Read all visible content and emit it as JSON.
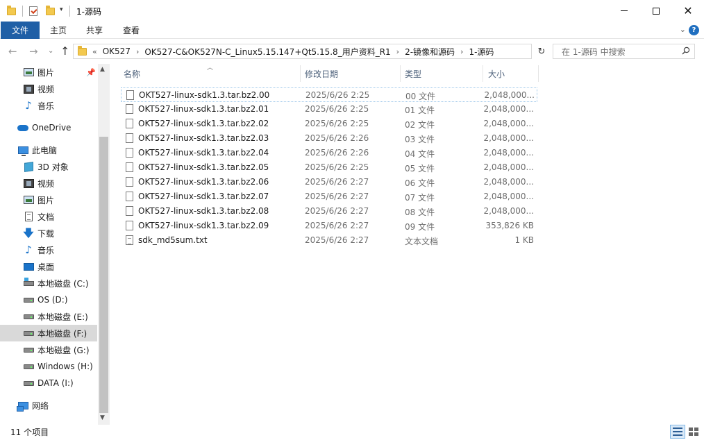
{
  "window": {
    "title": "1-源码"
  },
  "ribbon": {
    "tabs": [
      "文件",
      "主页",
      "共享",
      "查看"
    ]
  },
  "address": {
    "lead": "«",
    "segments": [
      "OK527",
      "OK527-C&OK527N-C_Linux5.15.147+Qt5.15.8_用户资料_R1",
      "2-镜像和源码",
      "1-源码"
    ]
  },
  "search": {
    "placeholder": "在 1-源码 中搜索"
  },
  "sidebar": {
    "items": [
      {
        "label": "图片",
        "icon": "pictures-icon"
      },
      {
        "label": "视频",
        "icon": "videos-icon"
      },
      {
        "label": "音乐",
        "icon": "music-icon"
      },
      {
        "label": "OneDrive",
        "icon": "onedrive-icon"
      },
      {
        "label": "此电脑",
        "icon": "this-pc-icon"
      },
      {
        "label": "3D 对象",
        "icon": "3d-objects-icon"
      },
      {
        "label": "视频",
        "icon": "videos-icon"
      },
      {
        "label": "图片",
        "icon": "pictures-icon"
      },
      {
        "label": "文档",
        "icon": "documents-icon"
      },
      {
        "label": "下载",
        "icon": "downloads-icon"
      },
      {
        "label": "音乐",
        "icon": "music-icon"
      },
      {
        "label": "桌面",
        "icon": "desktop-icon"
      },
      {
        "label": "本地磁盘 (C:)",
        "icon": "system-drive-icon"
      },
      {
        "label": "OS (D:)",
        "icon": "drive-icon"
      },
      {
        "label": "本地磁盘 (E:)",
        "icon": "drive-icon"
      },
      {
        "label": "本地磁盘 (F:)",
        "icon": "drive-icon",
        "selected": true
      },
      {
        "label": "本地磁盘 (G:)",
        "icon": "drive-icon"
      },
      {
        "label": "Windows (H:)",
        "icon": "drive-icon"
      },
      {
        "label": "DATA (I:)",
        "icon": "drive-icon"
      },
      {
        "label": "网络",
        "icon": "network-icon"
      }
    ]
  },
  "columns": {
    "name": "名称",
    "date": "修改日期",
    "type": "类型",
    "size": "大小"
  },
  "files": [
    {
      "name": "OKT527-linux-sdk1.3.tar.bz2.00",
      "date": "2025/6/26 2:25",
      "type": "00 文件",
      "size": "2,048,000..."
    },
    {
      "name": "OKT527-linux-sdk1.3.tar.bz2.01",
      "date": "2025/6/26 2:25",
      "type": "01 文件",
      "size": "2,048,000..."
    },
    {
      "name": "OKT527-linux-sdk1.3.tar.bz2.02",
      "date": "2025/6/26 2:25",
      "type": "02 文件",
      "size": "2,048,000..."
    },
    {
      "name": "OKT527-linux-sdk1.3.tar.bz2.03",
      "date": "2025/6/26 2:26",
      "type": "03 文件",
      "size": "2,048,000..."
    },
    {
      "name": "OKT527-linux-sdk1.3.tar.bz2.04",
      "date": "2025/6/26 2:26",
      "type": "04 文件",
      "size": "2,048,000..."
    },
    {
      "name": "OKT527-linux-sdk1.3.tar.bz2.05",
      "date": "2025/6/26 2:25",
      "type": "05 文件",
      "size": "2,048,000..."
    },
    {
      "name": "OKT527-linux-sdk1.3.tar.bz2.06",
      "date": "2025/6/26 2:27",
      "type": "06 文件",
      "size": "2,048,000..."
    },
    {
      "name": "OKT527-linux-sdk1.3.tar.bz2.07",
      "date": "2025/6/26 2:27",
      "type": "07 文件",
      "size": "2,048,000..."
    },
    {
      "name": "OKT527-linux-sdk1.3.tar.bz2.08",
      "date": "2025/6/26 2:27",
      "type": "08 文件",
      "size": "2,048,000..."
    },
    {
      "name": "OKT527-linux-sdk1.3.tar.bz2.09",
      "date": "2025/6/26 2:27",
      "type": "09 文件",
      "size": "353,826 KB"
    },
    {
      "name": "sdk_md5sum.txt",
      "date": "2025/6/26 2:27",
      "type": "文本文档",
      "size": "1 KB"
    }
  ],
  "status": {
    "count": "11 个项目"
  },
  "colors": {
    "file_tab": "#1f5fa6",
    "selected_nav": "#d9d9d9",
    "header_text": "#4c607a"
  }
}
